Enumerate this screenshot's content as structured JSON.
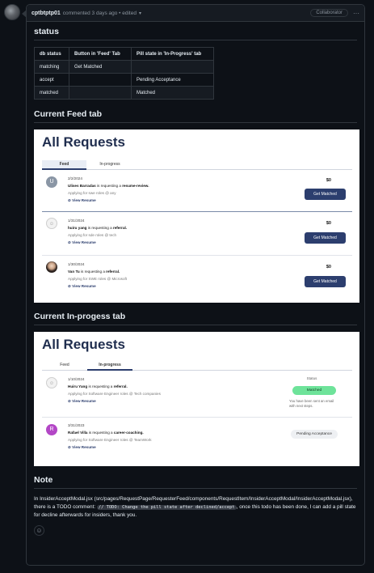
{
  "comment": {
    "author": "cptbtptp01",
    "meta": "commented 3 days ago • edited",
    "caret": "▾",
    "badge": "Collaborator",
    "menu": "···"
  },
  "status_section": {
    "heading": "status",
    "headers": [
      "db status",
      "Button in 'Feed' Tab",
      "Pill state in 'In-Progress' tab"
    ],
    "rows": [
      [
        "matching",
        "Get Matched",
        ""
      ],
      [
        "accept",
        "",
        "Pending Acceptance"
      ],
      [
        "matched",
        "",
        "Matched"
      ]
    ]
  },
  "feed_section": {
    "heading": "Current Feed tab",
    "title": "All Requests",
    "tabs": [
      "Feed",
      "In-progress"
    ],
    "rows": [
      {
        "avatar": "U",
        "date": "2/2/2024",
        "name": "Ulises Barradas",
        "mid": "is requesting a",
        "type": "resume-review.",
        "applying": "Applying for swe roles @ any",
        "view": "View Resume",
        "amount": "$0",
        "button": "Get Matched"
      },
      {
        "avatar": "",
        "date": "1/31/2024",
        "name": "huiru yang",
        "mid": "is requesting a",
        "type": "referral.",
        "applying": "Applying for sde roles @ tech",
        "view": "View Resume",
        "amount": "$0",
        "button": "Get Matched"
      },
      {
        "avatar": "",
        "date": "1/30/2024",
        "name": "Van Tu",
        "mid": "is requesting a",
        "type": "referral.",
        "applying": "Applying for SWE roles @ Microsoft",
        "view": "View Resume",
        "amount": "$0",
        "button": "Get Matched"
      }
    ]
  },
  "inprogress_section": {
    "heading": "Current In-progess tab",
    "title": "All Requests",
    "tabs": [
      "Feed",
      "In-progress"
    ],
    "status_label": "Status",
    "rows": [
      {
        "avatar": "",
        "date": "1/10/2024",
        "name": "Huiru Yang",
        "mid": "is requesting a",
        "type": "referral.",
        "applying": "Applying for Software Engineer roles @ Tech companies",
        "view": "View Resume",
        "pill": "Matched",
        "note": "You have been sent an email with next steps."
      },
      {
        "avatar": "R",
        "date": "3/31/2023",
        "name": "Rafael Villa",
        "mid": "is requesting a",
        "type": "career-coaching.",
        "applying": "Applying for Software Engineer roles @ TeamWork",
        "view": "View Resume",
        "pill": "Pending Acceptance"
      }
    ]
  },
  "note_section": {
    "heading": "Note",
    "text_1": "In InsiderAcceptModal.jsx (src/pages/RequestPage/RequesterFeed/components/RequestItem/InsiderAcceptModal/InsiderAcceptModal.jsx), there is a TODO comment:",
    "code": "// TODO: Change the pill state after declined/accept",
    "text_2": ", once this todo has been done, I can add a pill state for decline afterwards for insiders, thank you."
  },
  "colors": {
    "page_bg": "#0d1117",
    "border": "#30363d",
    "navy": "#2c3e6e",
    "pill_green": "#6ee39a"
  }
}
